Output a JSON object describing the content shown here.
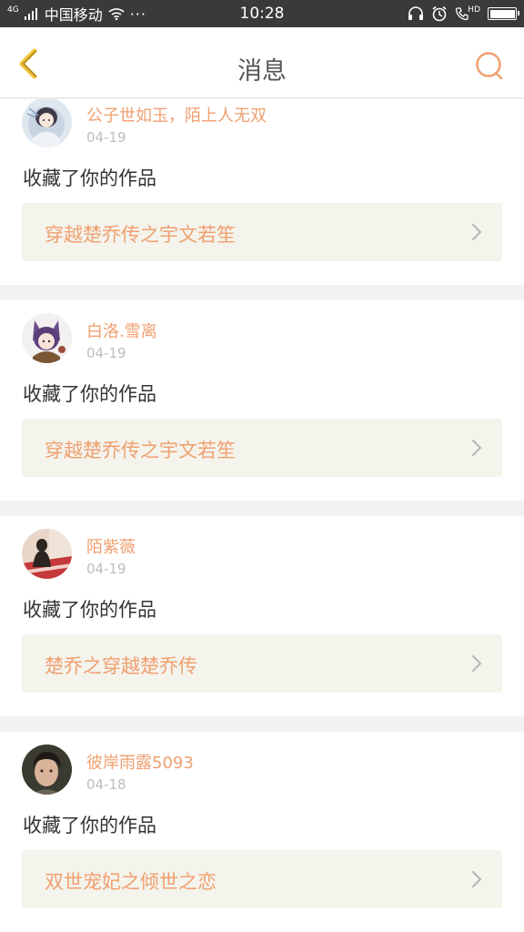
{
  "status_bar": {
    "network": "4G",
    "carrier": "中国移动",
    "more": "···",
    "time": "10:28",
    "hd_label": "HD"
  },
  "header": {
    "title": "消息"
  },
  "colors": {
    "accent": "#f0a070",
    "back_arrow": "#f2c230",
    "work_bg": "#f4f3ec"
  },
  "messages": [
    {
      "user": "公子世如玉，陌上人无双",
      "date": "04-19",
      "action": "收藏了你的作品",
      "work": "穿越楚乔传之宇文若笙",
      "avatar": "avatar-anime-girl-white"
    },
    {
      "user": "白洛.雪离",
      "date": "04-19",
      "action": "收藏了你的作品",
      "work": "穿越楚乔传之宇文若笙",
      "avatar": "avatar-anime-girl-purple"
    },
    {
      "user": "陌紫薇",
      "date": "04-19",
      "action": "收藏了你的作品",
      "work": "楚乔之穿越楚乔传",
      "avatar": "avatar-silhouette-red"
    },
    {
      "user": "彼岸雨露5093",
      "date": "04-18",
      "action": "收藏了你的作品",
      "work": "双世宠妃之倾世之恋",
      "avatar": "avatar-photo-man"
    }
  ]
}
